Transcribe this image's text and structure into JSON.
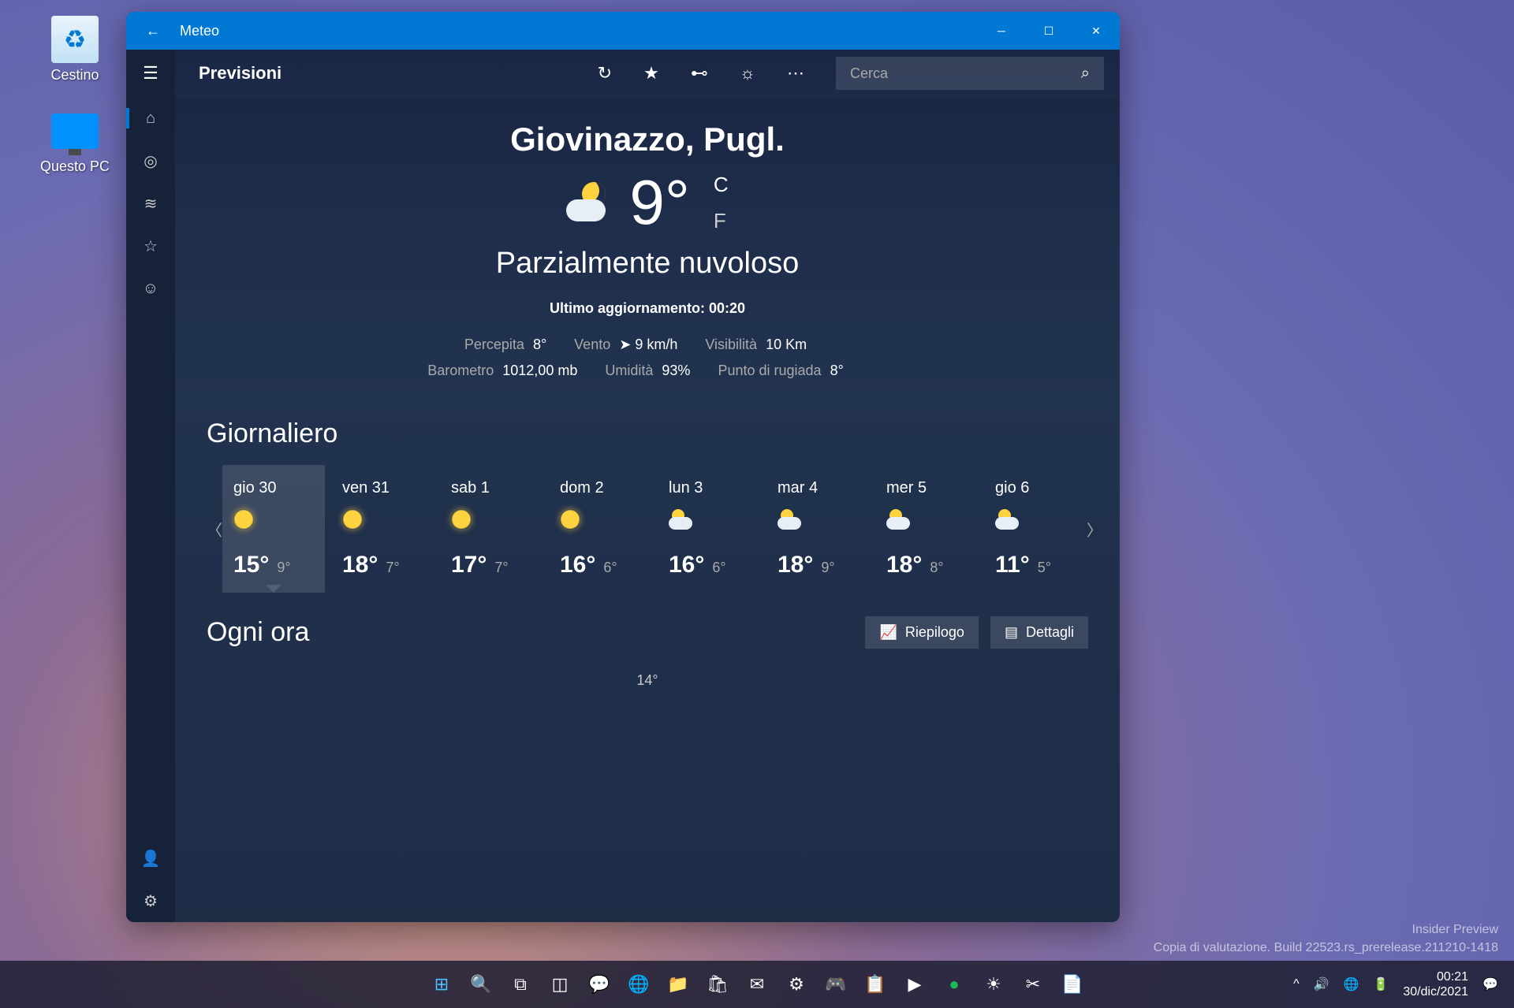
{
  "desktop": {
    "recycle_bin": "Cestino",
    "this_pc": "Questo PC"
  },
  "titlebar": {
    "app_name": "Meteo"
  },
  "toolbar": {
    "page_title": "Previsioni",
    "search_placeholder": "Cerca"
  },
  "current": {
    "location": "Giovinazzo, Pugl.",
    "temp": "9°",
    "unit_c": "C",
    "unit_f": "F",
    "condition": "Parzialmente nuvoloso",
    "updated": "Ultimo aggiornamento: 00:20",
    "details1": {
      "feels_label": "Percepita",
      "feels_val": "8°",
      "wind_label": "Vento",
      "wind_val": "➤ 9 km/h",
      "visibility_label": "Visibilità",
      "visibility_val": "10 Km"
    },
    "details2": {
      "barometer_label": "Barometro",
      "barometer_val": "1012,00 mb",
      "humidity_label": "Umidità",
      "humidity_val": "93%",
      "dewpoint_label": "Punto di rugiada",
      "dewpoint_val": "8°"
    }
  },
  "sections": {
    "daily": "Giornaliero",
    "hourly": "Ogni ora"
  },
  "daily": [
    {
      "name": "gio 30",
      "icon": "sun",
      "hi": "15°",
      "lo": "9°"
    },
    {
      "name": "ven 31",
      "icon": "sun",
      "hi": "18°",
      "lo": "7°"
    },
    {
      "name": "sab 1",
      "icon": "sun",
      "hi": "17°",
      "lo": "7°"
    },
    {
      "name": "dom 2",
      "icon": "sun",
      "hi": "16°",
      "lo": "6°"
    },
    {
      "name": "lun 3",
      "icon": "cloud-sun",
      "hi": "16°",
      "lo": "6°"
    },
    {
      "name": "mar 4",
      "icon": "cloud-sun",
      "hi": "18°",
      "lo": "9°"
    },
    {
      "name": "mer 5",
      "icon": "cloud-sun",
      "hi": "18°",
      "lo": "8°"
    },
    {
      "name": "gio 6",
      "icon": "cloud-sun",
      "hi": "11°",
      "lo": "5°"
    }
  ],
  "hourly": {
    "summary_btn": "Riepilogo",
    "details_btn": "Dettagli",
    "first_temp": "14°"
  },
  "watermark": {
    "line1": "Insider Preview",
    "line2": "Copia di valutazione. Build 22523.rs_prerelease.211210-1418"
  },
  "taskbar": {
    "time": "00:21",
    "date": "30/dic/2021"
  }
}
